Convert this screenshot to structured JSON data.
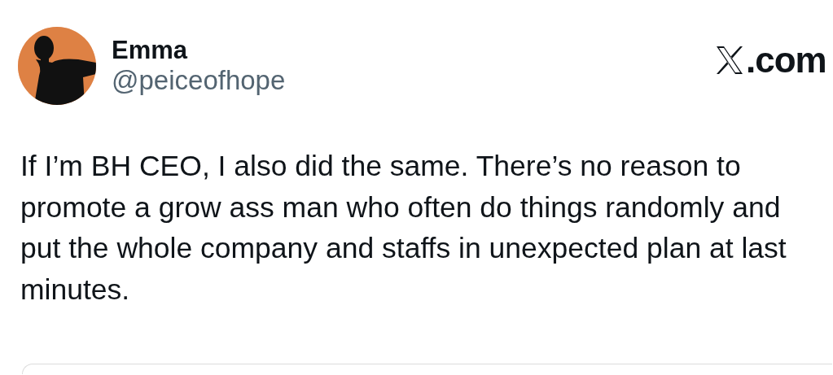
{
  "author": {
    "name": "Emma",
    "handle": "@peiceofhope"
  },
  "source_label": {
    "text": ".com"
  },
  "post": {
    "text": "If I’m BH CEO, I also did the same. There’s no reason to\npromote a grow ass man who often do things randomly and\nput the whole company and staffs in unexpected plan at last\nminutes."
  }
}
